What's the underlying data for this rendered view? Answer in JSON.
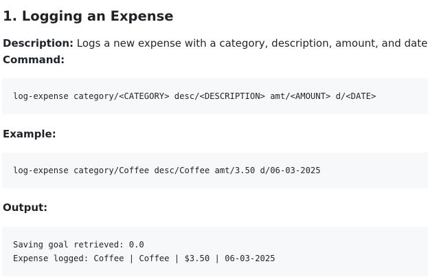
{
  "section": {
    "heading": "1. Logging an Expense",
    "description_label": "Description:",
    "description_text": " Logs a new expense with a category, description, amount, and date.",
    "command_label": "Command:",
    "command_code": "log-expense category/<CATEGORY> desc/<DESCRIPTION> amt/<AMOUNT> d/<DATE>",
    "example_label": "Example:",
    "example_code": "log-expense category/Coffee desc/Coffee amt/3.50 d/06-03-2025",
    "output_label": "Output:",
    "output_lines": [
      "Saving goal retrieved: 0.0",
      "Expense logged: Coffee | Coffee | $3.50 | 06-03-2025"
    ]
  }
}
